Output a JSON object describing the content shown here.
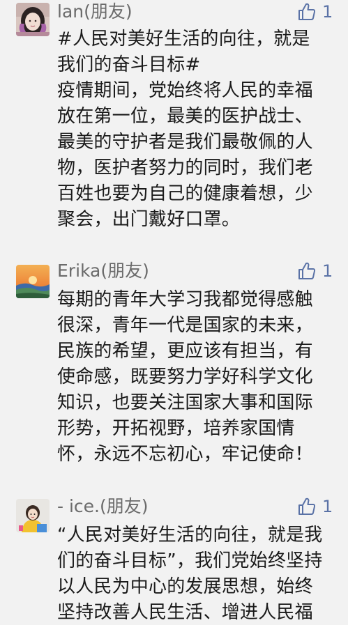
{
  "comments": [
    {
      "author": "lan(朋友)",
      "likes": "1",
      "avatar_icon": "user-avatar-portrait",
      "lines": [
        "#人民对美好生活的向往，就是",
        "我们的奋斗目标#",
        "疫情期间，党始终将人民的幸福",
        "放在第一位，最美的医护战士、",
        "最美的守护者是我们最敬佩的人",
        "物，医护者努力的同时，我们老",
        "百姓也要为自己的健康着想，少",
        "聚会，出门戴好口罩。"
      ]
    },
    {
      "author": "Erika(朋友)",
      "likes": "1",
      "avatar_icon": "user-avatar-sunset",
      "lines": [
        "每期的青年大学习我都觉得感触",
        "很深，青年一代是国家的未来，",
        "民族的希望，更应该有担当，有",
        "使命感，既要努力学好科学文化",
        "知识，也要关注国家大事和国际",
        "形势，开拓视野，培养家国情",
        "怀，永远不忘初心，牢记使命！"
      ]
    },
    {
      "author": "- ice.(朋友)",
      "likes": "1",
      "avatar_icon": "user-avatar-cartoon",
      "lines": [
        "“人民对美好生活的向往，就是我",
        "们的奋斗目标”，我们党始终坚持",
        "以人民为中心的发展思想，始终",
        "坚持改善人民生活、增进人民福"
      ]
    }
  ],
  "colors": {
    "background": "#f2f2f2",
    "author": "#6b6b6b",
    "like_accent": "#5a72a6",
    "text": "#1a1a1a"
  }
}
